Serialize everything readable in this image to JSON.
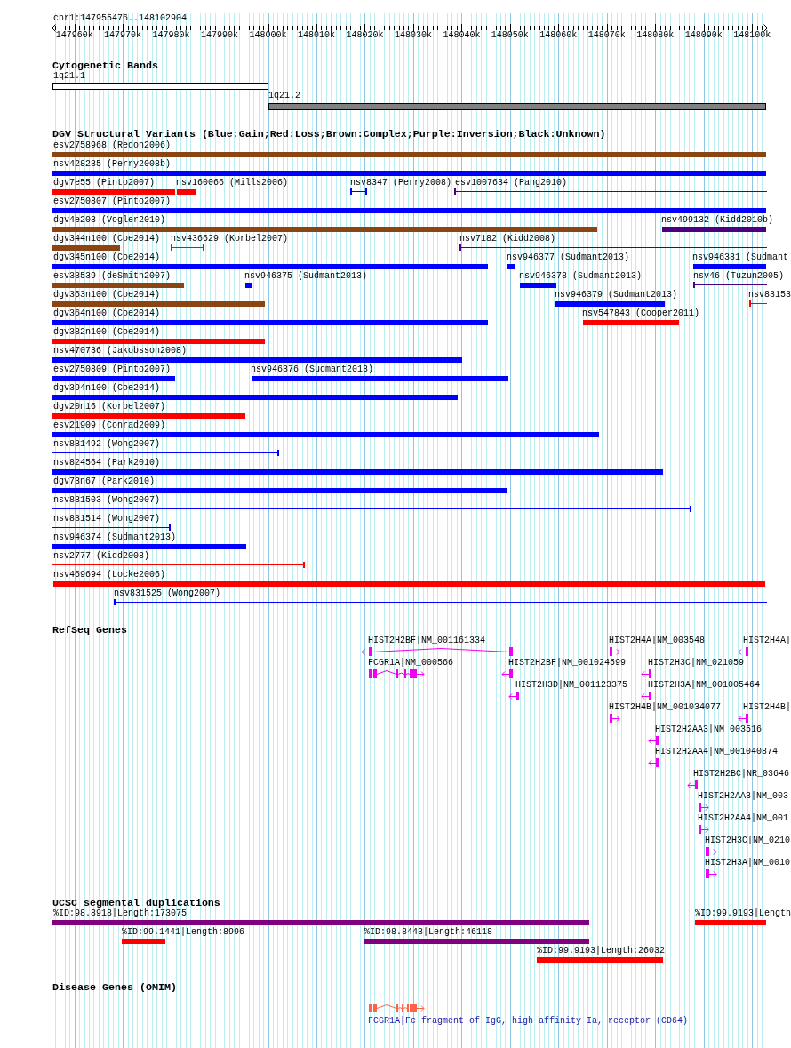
{
  "ruler": {
    "region": "chr1:147955476..148102904",
    "ticks": [
      "147960k",
      "147970k",
      "147980k",
      "147990k",
      "148000k",
      "148010k",
      "148020k",
      "148030k",
      "148040k",
      "148050k",
      "148060k",
      "148070k",
      "148080k",
      "148090k",
      "148100k"
    ]
  },
  "cytogenetic_bands": {
    "title": "Cytogenetic Bands",
    "bands": [
      {
        "label": "1q21.1",
        "color": "#ffffff"
      },
      {
        "label": "1q21.2",
        "color": "#808080"
      }
    ]
  },
  "dgv": {
    "title": "DGV Structural Variants (Blue:Gain;Red:Loss;Brown:Complex;Purple:Inversion;Black:Unknown)",
    "rows": [
      {
        "variants": [
          {
            "label": "esv2758968 (Redon2006)",
            "kind": "bar",
            "color": "#8b4513"
          }
        ]
      },
      {
        "variants": [
          {
            "label": "nsv428235 (Perry2008b)",
            "kind": "bar",
            "color": "#0000ff"
          }
        ]
      },
      {
        "variants": [
          {
            "label": "dgv7e55 (Pinto2007)",
            "kind": "bar",
            "color": "#ff0000"
          },
          {
            "label": "nsv160066 (Mills2006)",
            "kind": "bar",
            "color": "#ff0000"
          },
          {
            "label": "nsv8347 (Perry2008)",
            "kind": "span",
            "color": "#0000ff"
          },
          {
            "label": "esv1007634 (Pang2010)",
            "kind": "span",
            "color": "#4b0082"
          }
        ]
      },
      {
        "variants": [
          {
            "label": "esv2750807 (Pinto2007)",
            "kind": "bar",
            "color": "#0000ff"
          }
        ]
      },
      {
        "variants": [
          {
            "label": "dgv4e203 (Vogler2010)",
            "kind": "bar",
            "color": "#8b4513"
          },
          {
            "label": "nsv499132 (Kidd2010b)",
            "kind": "bar",
            "color": "#4b0082"
          }
        ]
      },
      {
        "variants": [
          {
            "label": "dgv344n100 (Coe2014)",
            "kind": "bar",
            "color": "#8b4513"
          },
          {
            "label": "nsv436629 (Korbel2007)",
            "kind": "span",
            "color": "#ff0000"
          },
          {
            "label": "nsv7182 (Kidd2008)",
            "kind": "span",
            "color": "#4b0082"
          }
        ]
      },
      {
        "variants": [
          {
            "label": "dgv345n100 (Coe2014)",
            "kind": "bar",
            "color": "#0000ff"
          },
          {
            "label": "nsv946377 (Sudmant2013)",
            "kind": "bar",
            "color": "#0000ff"
          },
          {
            "label": "nsv946381 (Sudmant",
            "kind": "bar",
            "color": "#0000ff"
          }
        ]
      },
      {
        "variants": [
          {
            "label": "esv33539 (deSmith2007)",
            "kind": "bar",
            "color": "#8b4513"
          },
          {
            "label": "nsv946375 (Sudmant2013)",
            "kind": "bar",
            "color": "#0000ff"
          },
          {
            "label": "nsv946378 (Sudmant2013)",
            "kind": "bar",
            "color": "#0000ff"
          },
          {
            "label": "nsv46 (Tuzun2005)",
            "kind": "span",
            "color": "#4b0082"
          }
        ]
      },
      {
        "variants": [
          {
            "label": "dgv363n100 (Coe2014)",
            "kind": "bar",
            "color": "#8b4513"
          },
          {
            "label": "nsv946379 (Sudmant2013)",
            "kind": "bar",
            "color": "#0000ff"
          },
          {
            "label": "nsv83153",
            "kind": "span",
            "color": "#ff0000"
          }
        ]
      },
      {
        "variants": [
          {
            "label": "dgv364n100 (Coe2014)",
            "kind": "bar",
            "color": "#0000ff"
          },
          {
            "label": "nsv547843 (Cooper2011)",
            "kind": "bar",
            "color": "#ff0000"
          }
        ]
      },
      {
        "variants": [
          {
            "label": "dgv382n100 (Coe2014)",
            "kind": "bar",
            "color": "#ff0000"
          }
        ]
      },
      {
        "variants": [
          {
            "label": "nsv470736 (Jakobsson2008)",
            "kind": "bar",
            "color": "#0000ff"
          }
        ]
      },
      {
        "variants": [
          {
            "label": "esv2750809 (Pinto2007)",
            "kind": "bar",
            "color": "#0000ff"
          },
          {
            "label": "nsv946376 (Sudmant2013)",
            "kind": "bar",
            "color": "#0000ff"
          }
        ]
      },
      {
        "variants": [
          {
            "label": "dgv394n100 (Coe2014)",
            "kind": "bar",
            "color": "#0000ff"
          }
        ]
      },
      {
        "variants": [
          {
            "label": "dgv20n16 (Korbel2007)",
            "kind": "bar",
            "color": "#ff0000"
          }
        ]
      },
      {
        "variants": [
          {
            "label": "esv21909 (Conrad2009)",
            "kind": "bar",
            "color": "#0000ff"
          }
        ]
      },
      {
        "variants": [
          {
            "label": "nsv831492 (Wong2007)",
            "kind": "span",
            "color": "#0000ff"
          }
        ]
      },
      {
        "variants": [
          {
            "label": "nsv824564 (Park2010)",
            "kind": "bar",
            "color": "#0000ff"
          }
        ]
      },
      {
        "variants": [
          {
            "label": "dgv73n67 (Park2010)",
            "kind": "bar",
            "color": "#0000ff"
          }
        ]
      },
      {
        "variants": [
          {
            "label": "nsv831503 (Wong2007)",
            "kind": "span",
            "color": "#0000ff"
          }
        ]
      },
      {
        "variants": [
          {
            "label": "nsv831514 (Wong2007)",
            "kind": "span",
            "color": "#0000ff"
          }
        ]
      },
      {
        "variants": [
          {
            "label": "nsv946374 (Sudmant2013)",
            "kind": "bar",
            "color": "#0000ff"
          }
        ]
      },
      {
        "variants": [
          {
            "label": "nsv2777 (Kidd2008)",
            "kind": "span",
            "color": "#ff0000"
          }
        ]
      },
      {
        "variants": [
          {
            "label": "nsv469694 (Locke2006)",
            "kind": "bar",
            "color": "#ff0000"
          }
        ]
      },
      {
        "variants": [
          {
            "label": "nsv831525 (Wong2007)",
            "kind": "span",
            "color": "#0000ff"
          }
        ]
      }
    ]
  },
  "refseq_genes": {
    "title": "RefSeq Genes",
    "rows": [
      {
        "genes": [
          {
            "label": "HIST2H2BF|NM_001161334",
            "reverse_strand": true
          },
          {
            "label": "HIST2H4A|NM_003548",
            "reverse_strand": false
          },
          {
            "label": "HIST2H4A|",
            "reverse_strand": true
          }
        ]
      },
      {
        "genes": [
          {
            "label": "FCGR1A|NM_000566",
            "reverse_strand": false
          },
          {
            "label": "HIST2H2BF|NM_001024599",
            "reverse_strand": true
          },
          {
            "label": "HIST2H3C|NM_021059",
            "reverse_strand": true
          }
        ]
      },
      {
        "genes": [
          {
            "label": "HIST2H3D|NM_001123375",
            "reverse_strand": true
          },
          {
            "label": "HIST2H3A|NM_001005464",
            "reverse_strand": true
          }
        ]
      },
      {
        "genes": [
          {
            "label": "HIST2H4B|NM_001034077",
            "reverse_strand": false
          },
          {
            "label": "HIST2H4B|",
            "reverse_strand": true
          }
        ]
      },
      {
        "genes": [
          {
            "label": "HIST2H2AA3|NM_003516",
            "reverse_strand": true
          }
        ]
      },
      {
        "genes": [
          {
            "label": "HIST2H2AA4|NM_001040874",
            "reverse_strand": true
          }
        ]
      },
      {
        "genes": [
          {
            "label": "HIST2H2BC|NR_03646",
            "reverse_strand": true
          }
        ]
      },
      {
        "genes": [
          {
            "label": "HIST2H2AA3|NM_003",
            "reverse_strand": false
          }
        ]
      },
      {
        "genes": [
          {
            "label": "HIST2H2AA4|NM_001",
            "reverse_strand": false
          }
        ]
      },
      {
        "genes": [
          {
            "label": "HIST2H3C|NM_0210",
            "reverse_strand": false
          }
        ]
      },
      {
        "genes": [
          {
            "label": "HIST2H3A|NM_0010",
            "reverse_strand": false
          }
        ]
      }
    ]
  },
  "segmental_duplications": {
    "title": "UCSC segmental duplications",
    "rows": [
      {
        "items": [
          {
            "label": "%ID:98.8918|Length:173075",
            "color": "#800080"
          },
          {
            "label": "%ID:99.9193|Length",
            "color": "#ff0000"
          }
        ]
      },
      {
        "items": [
          {
            "label": "%ID:99.1441|Length:8996",
            "color": "#ff0000"
          },
          {
            "label": "%ID:98.8443|Length:46118",
            "color": "#800080"
          }
        ]
      },
      {
        "items": [
          {
            "label": "%ID:99.9193|Length:26032",
            "color": "#ff0000"
          }
        ]
      }
    ]
  },
  "disease_genes": {
    "title": "Disease Genes (OMIM)",
    "genes": [
      {
        "label": "FCGR1A|Fc fragment of IgG, high affinity Ia, receptor (CD64)",
        "reverse_strand": false
      }
    ]
  }
}
